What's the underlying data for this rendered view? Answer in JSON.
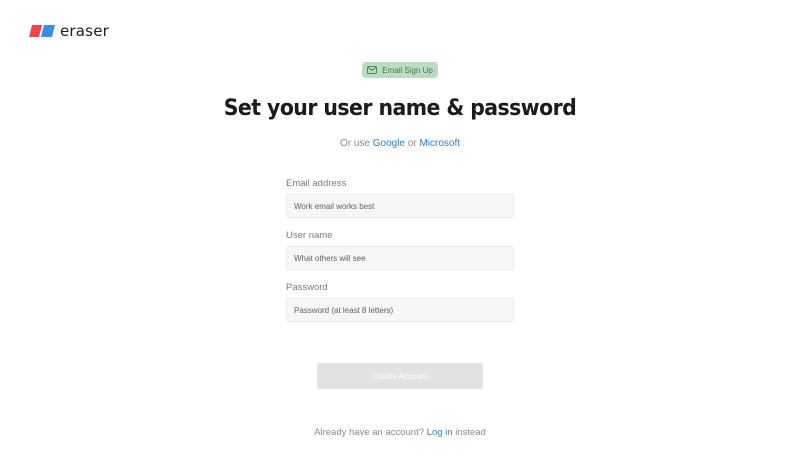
{
  "brand": {
    "name": "eraser",
    "colors": {
      "red": "#f2414f",
      "blue": "#3b8ee8"
    }
  },
  "badge": {
    "icon": "mail-icon",
    "label": "Email Sign Up"
  },
  "heading": "Set your user name & password",
  "alt_login": {
    "prefix": "Or use",
    "google": "Google",
    "or": "or",
    "microsoft": "Microsoft"
  },
  "form": {
    "email": {
      "label": "Email address",
      "placeholder": "Work email works best",
      "value": ""
    },
    "username": {
      "label": "User name",
      "placeholder": "What others will see",
      "value": ""
    },
    "password": {
      "label": "Password",
      "placeholder": "Password (at least 8 letters)",
      "value": ""
    }
  },
  "submit": {
    "label": "Create Account",
    "enabled": false
  },
  "footer": {
    "prefix": "Already have an account?",
    "login": "Log in",
    "suffix": "instead"
  },
  "colors": {
    "accent_link": "#3a78d4",
    "badge_bg": "#bcdcc2",
    "button_disabled": "#e2e2e2"
  }
}
